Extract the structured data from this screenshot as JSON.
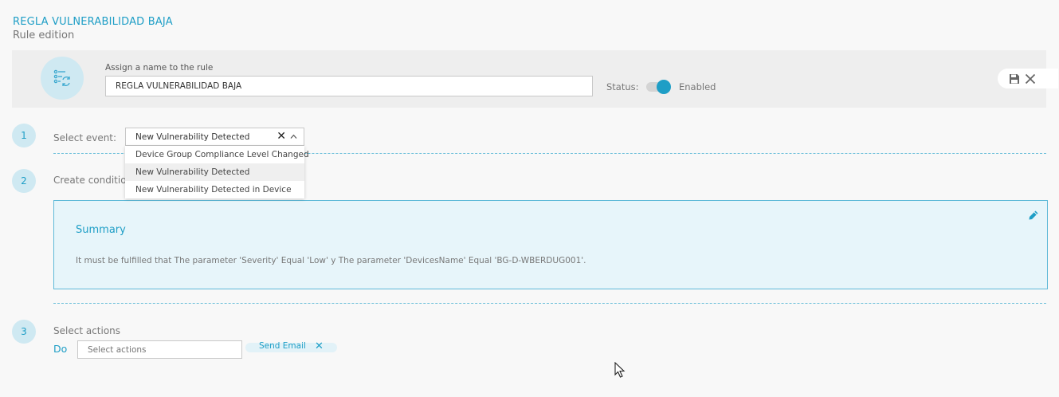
{
  "header": {
    "title": "REGLA VULNERABILIDAD BAJA",
    "subtitle": "Rule edition"
  },
  "rule": {
    "icon": "rule-settings-icon",
    "name_label": "Assign a name to the rule",
    "name_value": "REGLA VULNERABILIDAD BAJA",
    "status_label": "Status:",
    "status_value": "Enabled",
    "enabled": true,
    "actions": [
      "save-icon",
      "close-icon"
    ]
  },
  "steps": [
    {
      "number": "1",
      "label": "Select event:",
      "selected": "New Vulnerability Detected",
      "options": [
        "Device Group Compliance Level Changed",
        "New Vulnerability Detected",
        "New Vulnerability Detected in Device"
      ]
    },
    {
      "number": "2",
      "label": "Create conditions"
    },
    {
      "number": "3",
      "label": "Select actions"
    }
  ],
  "summary": {
    "title": "Summary",
    "text": "It must be fulfilled that The parameter 'Severity' Equal 'Low' y The parameter 'DevicesName' Equal 'BG-D-WBERDUG001'."
  },
  "actions": {
    "do_label": "Do",
    "placeholder": "Select actions",
    "chips": [
      "Send Email"
    ]
  },
  "colors": {
    "accent": "#1e9ec6",
    "light_accent": "#cfe9f2",
    "summary_bg": "#e7f5fa"
  }
}
